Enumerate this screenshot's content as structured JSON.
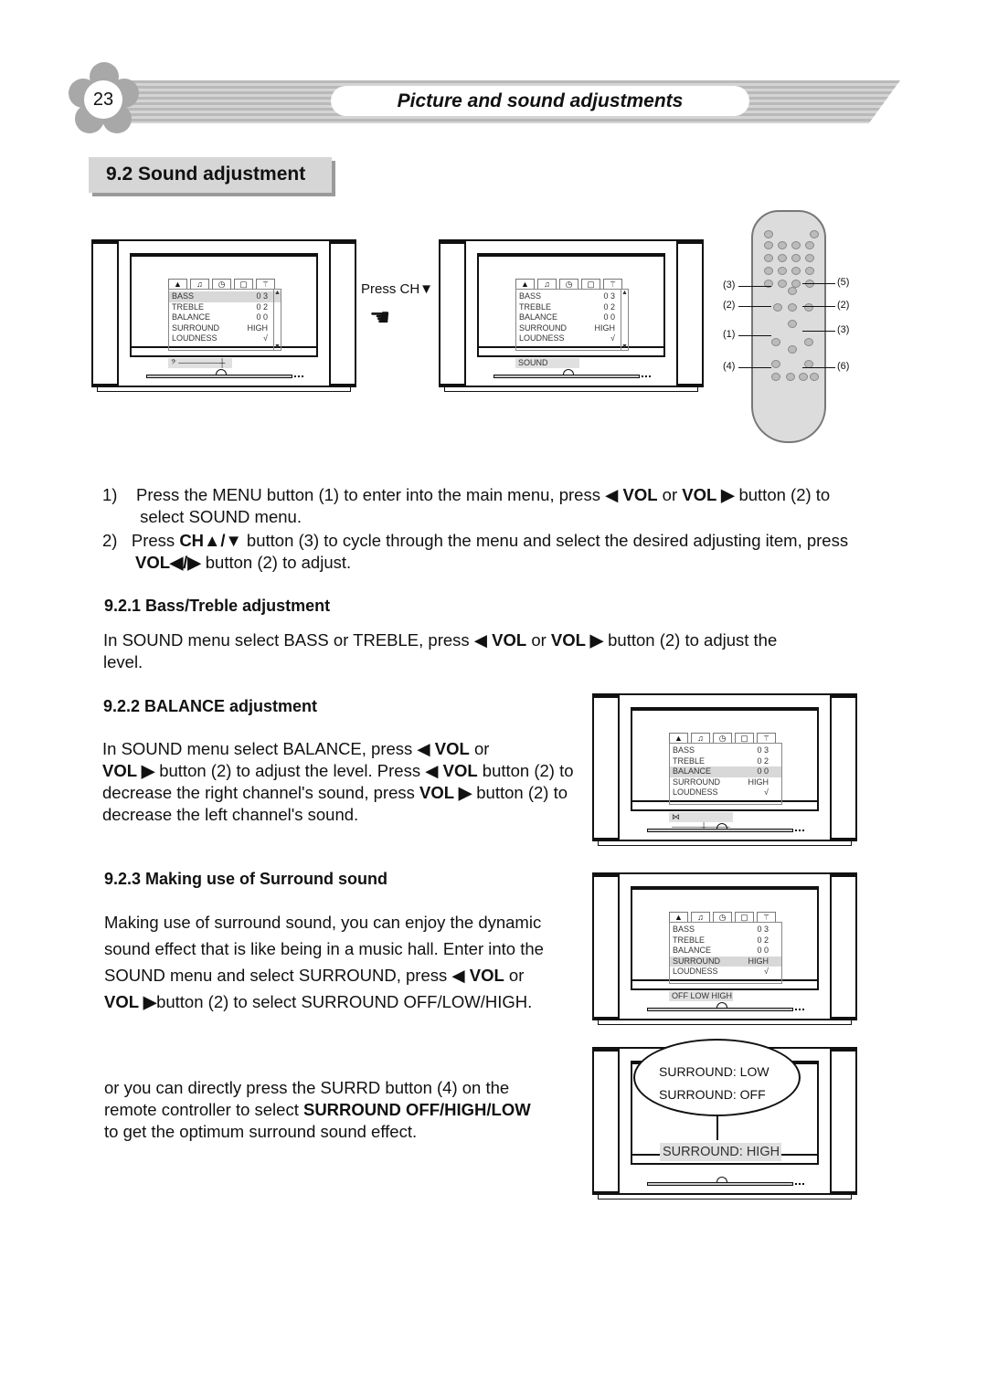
{
  "header": {
    "page_number": "23",
    "title": "Picture and sound adjustments"
  },
  "section_title": "9.2 Sound adjustment",
  "press_label": "Press CH▼",
  "menu_tabs": [
    "▲",
    "♫",
    "◷",
    "▢",
    "⚚"
  ],
  "menu_rows": [
    {
      "label": "BASS",
      "value": "0 3"
    },
    {
      "label": "TREBLE",
      "value": "0 2"
    },
    {
      "label": "BALANCE",
      "value": "0 0"
    },
    {
      "label": "SURROUND",
      "value": "HIGH"
    },
    {
      "label": "LOUDNESS",
      "value": "√"
    }
  ],
  "tvs": [
    {
      "highlight": 0,
      "sub": "𝄢 ───────┼",
      "scroll": true
    },
    {
      "highlight": -1,
      "sub": "SOUND",
      "scroll": true
    },
    {
      "highlight": 2,
      "sub": "⋈ ─────┼────",
      "scroll": false
    },
    {
      "highlight": 3,
      "sub": "OFF  LOW  HIGH",
      "scroll": false
    }
  ],
  "surround_popup": {
    "options": [
      "SURROUND: LOW",
      "SURROUND: OFF"
    ],
    "current": "SURROUND: HIGH"
  },
  "remote_labels": {
    "left": [
      "(3)",
      "(2)",
      "(1)",
      "(4)"
    ],
    "right": [
      "(5)",
      "(2)",
      "(3)",
      "(6)"
    ]
  },
  "steps": [
    [
      {
        "t": "1)    Press the MENU button (1) to enter into the main menu, press ◀ "
      },
      {
        "t": "VOL",
        "b": 1
      },
      {
        "t": " or "
      },
      {
        "t": "VOL ▶",
        "b": 1
      },
      {
        "t": " button (2) to"
      }
    ],
    [
      {
        "t": "        select SOUND menu."
      }
    ],
    [
      {
        "t": "2)   Press "
      },
      {
        "t": "CH▲/▼",
        "b": 1
      },
      {
        "t": " button (3) to cycle through the menu and select the desired adjusting item, press"
      }
    ],
    [
      {
        "t": "       "
      },
      {
        "t": "VOL◀/▶",
        "b": 1
      },
      {
        "t": " button (2) to adjust."
      }
    ]
  ],
  "bass": {
    "heading": "9.2.1 Bass/Treble adjustment",
    "lines": [
      [
        {
          "t": "In SOUND menu select BASS or TREBLE, press ◀ "
        },
        {
          "t": "VOL",
          "b": 1
        },
        {
          "t": " or "
        },
        {
          "t": "VOL ▶",
          "b": 1
        },
        {
          "t": " button (2) to adjust the"
        }
      ],
      [
        {
          "t": "level."
        }
      ]
    ]
  },
  "balance": {
    "heading": "9.2.2 BALANCE adjustment",
    "lines": [
      [
        {
          "t": "In SOUND menu select BALANCE, press ◀ "
        },
        {
          "t": "VOL",
          "b": 1
        },
        {
          "t": " or"
        }
      ],
      [
        {
          "t": "VOL ▶",
          "b": 1
        },
        {
          "t": " button (2) to adjust the level. Press ◀ "
        },
        {
          "t": "VOL",
          "b": 1
        },
        {
          "t": " button (2) to"
        }
      ],
      [
        {
          "t": "decrease the right channel's sound, press "
        },
        {
          "t": "VOL ▶",
          "b": 1
        },
        {
          "t": " button (2) to"
        }
      ],
      [
        {
          "t": "decrease the left channel's sound."
        }
      ]
    ]
  },
  "surround": {
    "heading": "9.2.3 Making use of Surround sound",
    "lines": [
      [
        {
          "t": "Making use of surround sound, you can enjoy the dynamic"
        }
      ],
      [
        {
          "t": "sound effect that is like being in a music hall. Enter into the"
        }
      ],
      [
        {
          "t": "SOUND menu and select SURROUND, press ◀ "
        },
        {
          "t": "VOL",
          "b": 1
        },
        {
          "t": " or"
        }
      ],
      [
        {
          "t": "VOL ▶",
          "b": 1
        },
        {
          "t": "button (2) to select SURROUND OFF/LOW/HIGH."
        }
      ]
    ],
    "lines2": [
      [
        {
          "t": "or you can directly press the SURRD button (4) on the"
        }
      ],
      [
        {
          "t": "remote controller to select "
        },
        {
          "t": "SURROUND OFF/HIGH/LOW",
          "b": 1
        }
      ],
      [
        {
          "t": "to get the optimum surround sound effect."
        }
      ]
    ]
  }
}
